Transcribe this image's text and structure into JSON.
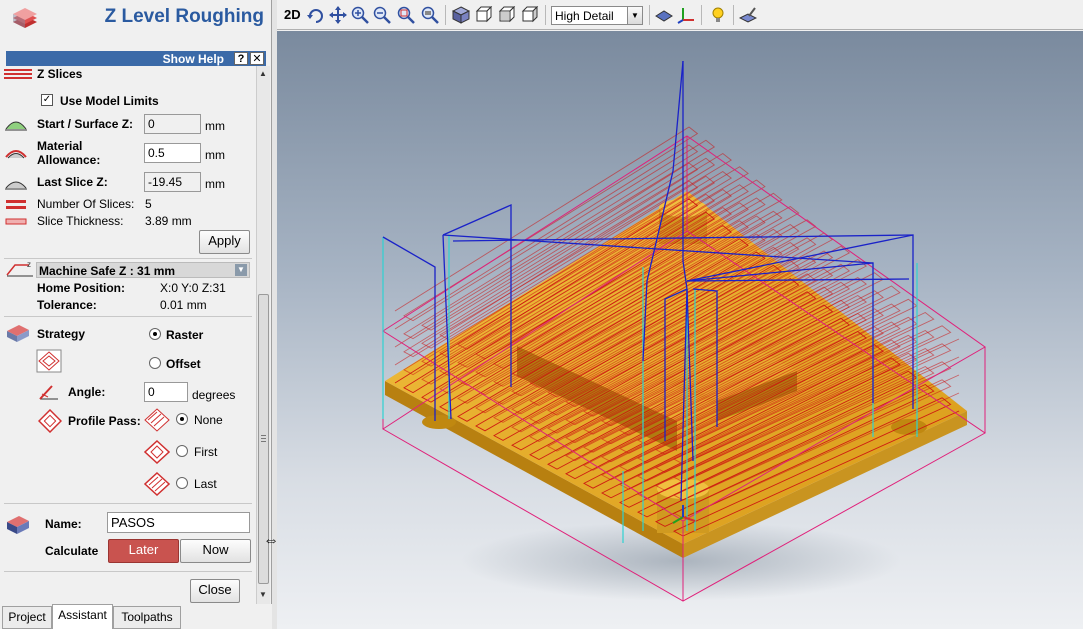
{
  "panel": {
    "title": "Z Level Roughing",
    "help_label": "Show Help",
    "help_btn": "?",
    "close_btn": "✕"
  },
  "zslices": {
    "section_title": "Z Slices",
    "use_model_limits": "Use Model Limits",
    "start_label": "Start / Surface Z:",
    "start_value": "0",
    "allowance_label_1": "Material",
    "allowance_label_2": "Allowance:",
    "allowance_value": "0.5",
    "last_label": "Last Slice Z:",
    "last_value": "-19.45",
    "unit": "mm",
    "num_slices_label": "Number Of Slices:",
    "num_slices_value": "5",
    "thickness_label": "Slice Thickness:",
    "thickness_value": "3.89 mm",
    "apply": "Apply"
  },
  "safe_z": {
    "label": "Machine Safe Z : 31 mm",
    "home_label": "Home Position:",
    "home_value": "X:0 Y:0 Z:31",
    "tolerance_label": "Tolerance:",
    "tolerance_value": "0.01 mm"
  },
  "strategy": {
    "label": "Strategy",
    "raster": "Raster",
    "offset": "Offset",
    "angle_label": "Angle:",
    "angle_value": "0",
    "angle_unit": "degrees",
    "profile_label": "Profile Pass:",
    "none": "None",
    "first": "First",
    "last": "Last"
  },
  "toolpath": {
    "name_label": "Name:",
    "name_value": "PASOS",
    "calculate_label": "Calculate",
    "later": "Later",
    "now": "Now",
    "close": "Close"
  },
  "tabs": [
    "Project",
    "Assistant",
    "Toolpaths"
  ],
  "toolbar": {
    "mode_2d": "2D",
    "quality": "High Detail"
  },
  "colors": {
    "accent_blue": "#2a5aa0",
    "later_red": "#c9534f",
    "model_gold": "#e0a520",
    "toolpath_red": "#cc1010",
    "rapid_blue": "#1a22c8",
    "plunge_cyan": "#2ed2d2",
    "box_magenta": "#e0207a"
  }
}
